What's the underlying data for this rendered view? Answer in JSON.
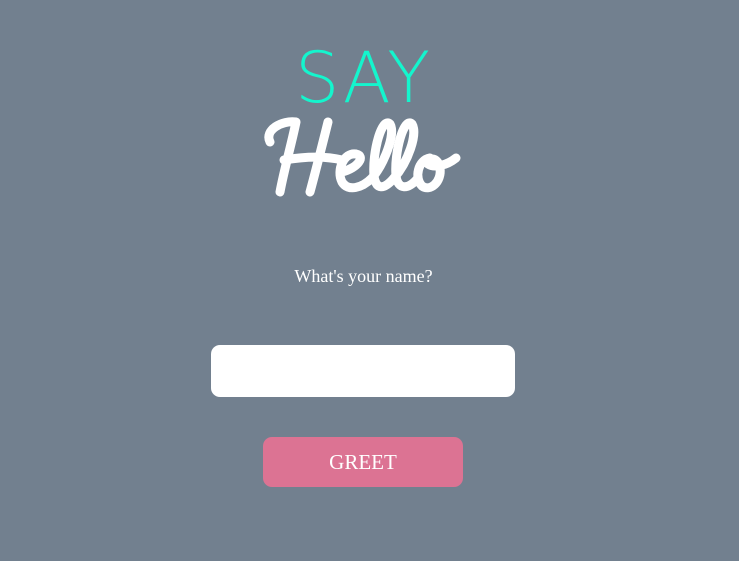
{
  "logo": {
    "line1": "SAY",
    "line2": "Hello"
  },
  "form": {
    "prompt": "What's your name?",
    "name_input": {
      "value": "",
      "placeholder": ""
    },
    "greet_label": "GREET"
  },
  "colors": {
    "background": "#72808f",
    "accent_say": "#14f5cd",
    "button": "#dc7393",
    "text": "#ffffff"
  }
}
